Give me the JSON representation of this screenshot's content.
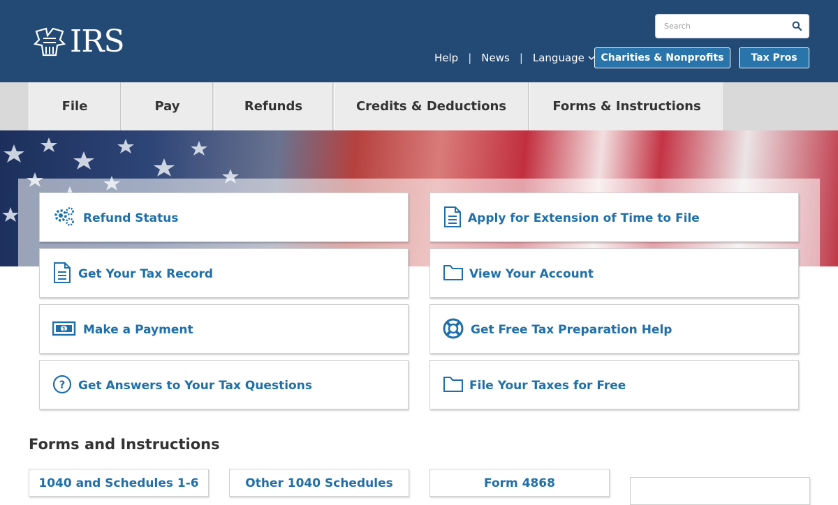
{
  "header": {
    "logo_text": "IRS",
    "search": {
      "placeholder": "Search"
    },
    "util_links": {
      "help": "Help",
      "news": "News",
      "language": "Language"
    },
    "buttons": {
      "charities": "Charities & Nonprofits",
      "tax_pros": "Tax Pros"
    }
  },
  "nav": {
    "tabs": [
      {
        "label": "File"
      },
      {
        "label": "Pay"
      },
      {
        "label": "Refunds"
      },
      {
        "label": "Credits & Deductions"
      },
      {
        "label": "Forms & Instructions"
      }
    ]
  },
  "quick_links": [
    {
      "label": "Refund Status",
      "icon": "gears-icon"
    },
    {
      "label": "Apply for Extension of Time to File",
      "icon": "document-icon"
    },
    {
      "label": "Get Your Tax Record",
      "icon": "document-icon"
    },
    {
      "label": "View Your Account",
      "icon": "folder-icon"
    },
    {
      "label": "Make a Payment",
      "icon": "money-icon"
    },
    {
      "label": "Get Free Tax Preparation Help",
      "icon": "lifebuoy-icon"
    },
    {
      "label": "Get Answers to Your Tax Questions",
      "icon": "question-icon"
    },
    {
      "label": "File Your Taxes for Free",
      "icon": "folder-icon"
    }
  ],
  "forms_section": {
    "title": "Forms and Instructions",
    "cards": [
      {
        "label": "1040 and Schedules 1-6"
      },
      {
        "label": "Other 1040 Schedules"
      },
      {
        "label": "Form 4868"
      },
      {
        "label": ""
      }
    ]
  },
  "colors": {
    "header_bg": "#224a75",
    "link_blue": "#1f6fa8",
    "nav_bg": "#ececec"
  }
}
